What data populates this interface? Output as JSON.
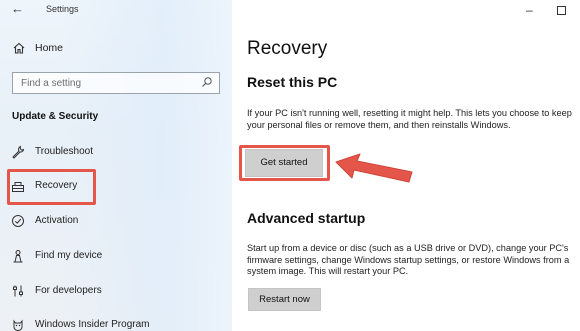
{
  "window": {
    "app_title": "Settings",
    "back_icon": "back-arrow-icon",
    "minimize_symbol": "–",
    "maximize_icon": "maximize-icon"
  },
  "sidebar": {
    "home_label": "Home",
    "home_icon": "home-icon",
    "search_placeholder": "Find a setting",
    "search_icon": "search-icon",
    "section_title": "Update & Security",
    "items": [
      {
        "label": "Troubleshoot",
        "icon": "wrench-icon"
      },
      {
        "label": "Recovery",
        "icon": "recovery-icon",
        "selected": true
      },
      {
        "label": "Activation",
        "icon": "activation-check-icon"
      },
      {
        "label": "Find my device",
        "icon": "person-location-icon"
      },
      {
        "label": "For developers",
        "icon": "developer-sliders-icon"
      },
      {
        "label": "Windows Insider Program",
        "icon": "insider-cat-icon"
      }
    ]
  },
  "main": {
    "page_title": "Recovery",
    "reset": {
      "heading": "Reset this PC",
      "description": "If your PC isn't running well, resetting it might help. This lets you choose to keep your personal files or remove them, and then reinstalls Windows.",
      "button_label": "Get started"
    },
    "advanced": {
      "heading": "Advanced startup",
      "description": "Start up from a device or disc (such as a USB drive or DVD), change your PC's firmware settings, change Windows startup settings, or restore Windows from a system image. This will restart your PC.",
      "button_label": "Restart now"
    }
  },
  "annotations": {
    "highlight_color": "#e4554a",
    "arrow_icon": "red-arrow-pointer"
  }
}
